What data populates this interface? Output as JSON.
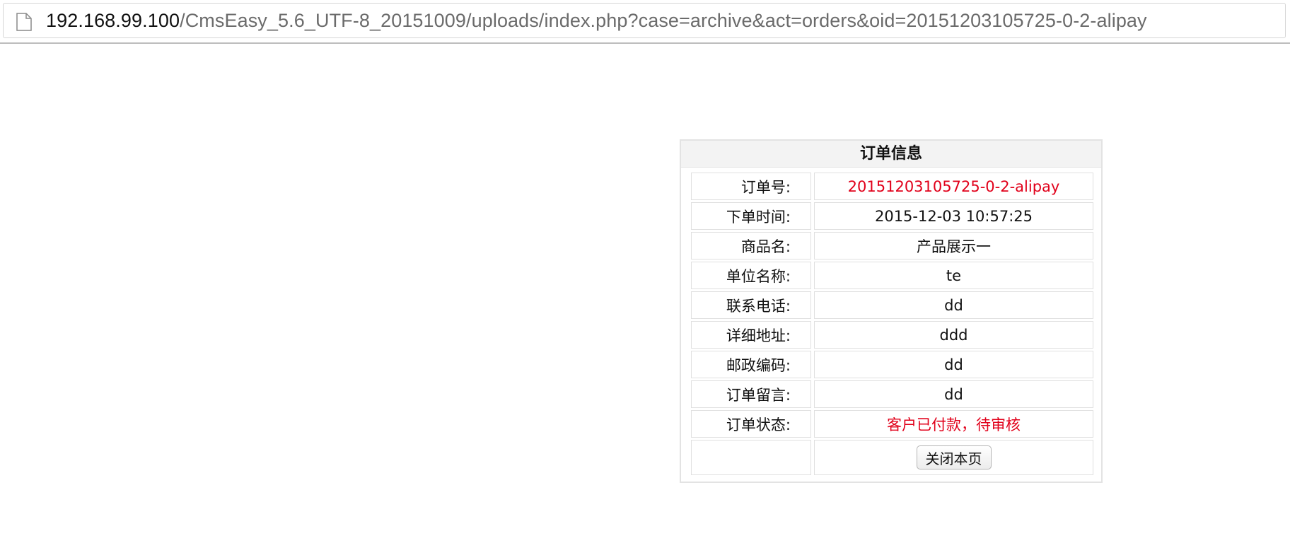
{
  "browser": {
    "url_host": "192.168.99.100",
    "url_path": "/CmsEasy_5.6_UTF-8_20151009/uploads/index.php?case=archive&act=orders&oid=20151203105725-0-2-alipay",
    "page_icon": "document-icon"
  },
  "order": {
    "title": "订单信息",
    "rows": [
      {
        "label": "订单号:",
        "value": "20151203105725-0-2-alipay"
      },
      {
        "label": "下单时间:",
        "value": "2015-12-03 10:57:25"
      },
      {
        "label": "商品名:",
        "value": "产品展示一"
      },
      {
        "label": "单位名称:",
        "value": "te"
      },
      {
        "label": "联系电话:",
        "value": "dd"
      },
      {
        "label": "详细地址:",
        "value": "ddd"
      },
      {
        "label": "邮政编码:",
        "value": "dd"
      },
      {
        "label": "订单留言:",
        "value": "dd"
      },
      {
        "label": "订单状态:",
        "value": "客户已付款，待审核"
      }
    ],
    "close_button_label": "关闭本页",
    "highlight_color": "#e1001a"
  }
}
